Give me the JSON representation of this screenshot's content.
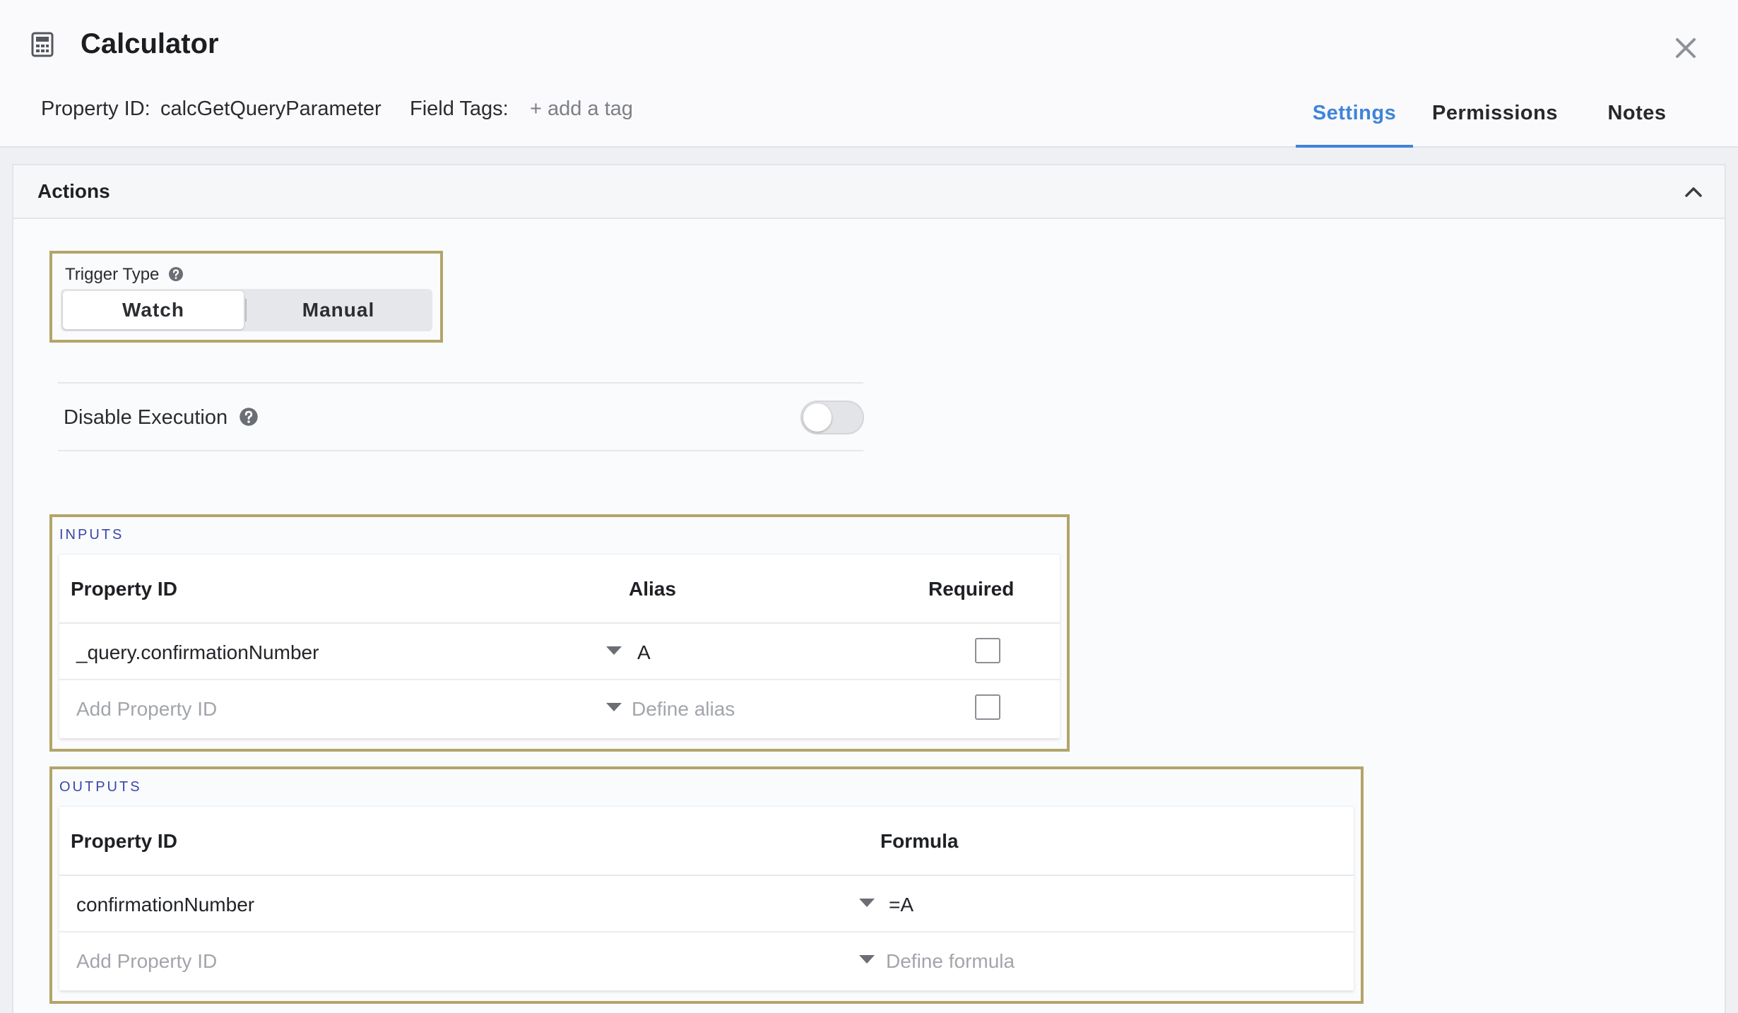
{
  "header": {
    "title": "Calculator",
    "property_id_label": "Property ID:",
    "property_id_value": "calcGetQueryParameter",
    "field_tags_label": "Field Tags:",
    "add_tag_label": "+ add a tag",
    "tabs": [
      {
        "label": "Settings",
        "active": true
      },
      {
        "label": "Permissions",
        "active": false
      },
      {
        "label": "Notes",
        "active": false
      }
    ]
  },
  "actions": {
    "title": "Actions",
    "trigger_type": {
      "label": "Trigger Type",
      "options": [
        "Watch",
        "Manual"
      ],
      "selected": "Watch"
    },
    "disable_execution": {
      "label": "Disable Execution",
      "enabled": false
    }
  },
  "inputs": {
    "section_label": "INPUTS",
    "columns": [
      "Property ID",
      "Alias",
      "Required"
    ],
    "rows": [
      {
        "property_id": "_query.confirmationNumber",
        "alias": "A",
        "required": false
      }
    ],
    "new_row": {
      "property_placeholder": "Add Property ID",
      "alias_placeholder": "Define alias"
    }
  },
  "outputs": {
    "section_label": "OUTPUTS",
    "columns": [
      "Property ID",
      "Formula"
    ],
    "rows": [
      {
        "property_id": "confirmationNumber",
        "formula": "=A"
      }
    ],
    "new_row": {
      "property_placeholder": "Add Property ID",
      "formula_placeholder": "Define formula"
    }
  },
  "colors": {
    "accent": "#3f84d9",
    "highlight_border": "#b3a46a",
    "section_label": "#3b47a8"
  },
  "icons": {
    "app": "calculator-icon",
    "close": "close-icon",
    "collapse": "chevron-up-icon",
    "help": "help-circle-icon",
    "dropdown": "caret-down-icon"
  }
}
